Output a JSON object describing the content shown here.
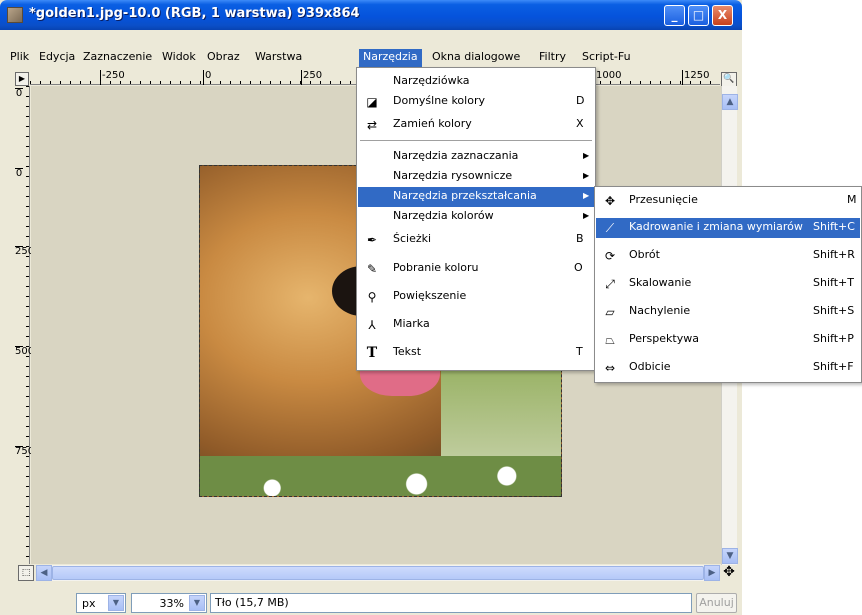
{
  "window": {
    "title": "*golden1.jpg-10.0 (RGB, 1 warstwa) 939x864",
    "minimize": "_",
    "maximize": "□",
    "close": "X"
  },
  "menubar": {
    "items": [
      "Plik",
      "Edycja",
      "Zaznaczenie",
      "Widok",
      "Obraz",
      "Warstwa",
      "Narzędzia",
      "Okna dialogowe",
      "Filtry",
      "Script-Fu"
    ],
    "active": "Narzędzia"
  },
  "rulers": {
    "top_labels": [
      "-250",
      "0",
      "250",
      "1000",
      "1250"
    ],
    "left_labels": [
      "0",
      "0",
      "250",
      "500",
      "750"
    ]
  },
  "tools_menu": {
    "items": [
      {
        "label": "Narzędziówka",
        "shortcut": "",
        "icon": "",
        "submenu": false
      },
      {
        "label": "Domyślne kolory",
        "shortcut": "D",
        "icon": "default-colors-icon",
        "submenu": false
      },
      {
        "label": "Zamień kolory",
        "shortcut": "X",
        "icon": "swap-colors-icon",
        "submenu": false
      },
      {
        "label": "Narzędzia zaznaczania",
        "shortcut": "",
        "icon": "",
        "submenu": true
      },
      {
        "label": "Narzędzia rysownicze",
        "shortcut": "",
        "icon": "",
        "submenu": true
      },
      {
        "label": "Narzędzia przekształcania",
        "shortcut": "",
        "icon": "",
        "submenu": true
      },
      {
        "label": "Narzędzia kolorów",
        "shortcut": "",
        "icon": "",
        "submenu": true
      },
      {
        "label": "Ścieżki",
        "shortcut": "B",
        "icon": "paths-icon",
        "submenu": false
      },
      {
        "label": "Pobranie koloru",
        "shortcut": "O",
        "icon": "color-picker-icon",
        "submenu": false
      },
      {
        "label": "Powiększenie",
        "shortcut": "",
        "icon": "magnify-icon",
        "submenu": false
      },
      {
        "label": "Miarka",
        "shortcut": "",
        "icon": "measure-icon",
        "submenu": false
      },
      {
        "label": "Tekst",
        "shortcut": "T",
        "icon": "text-icon",
        "submenu": false
      }
    ],
    "highlighted": "Narzędzia przekształcania"
  },
  "transform_submenu": {
    "items": [
      {
        "label": "Przesunięcie",
        "shortcut": "M",
        "icon": "move-icon"
      },
      {
        "label": "Kadrowanie i zmiana wymiarów",
        "shortcut": "Shift+C",
        "icon": "crop-icon"
      },
      {
        "label": "Obrót",
        "shortcut": "Shift+R",
        "icon": "rotate-icon"
      },
      {
        "label": "Skalowanie",
        "shortcut": "Shift+T",
        "icon": "scale-icon"
      },
      {
        "label": "Nachylenie",
        "shortcut": "Shift+S",
        "icon": "shear-icon"
      },
      {
        "label": "Perspektywa",
        "shortcut": "Shift+P",
        "icon": "perspective-icon"
      },
      {
        "label": "Odbicie",
        "shortcut": "Shift+F",
        "icon": "flip-icon"
      }
    ],
    "highlighted": "Kadrowanie i zmiana wymiarów"
  },
  "statusbar": {
    "unit": "px",
    "zoom": "33%",
    "status": "Tło (15,7 MB)",
    "cancel": "Anuluj"
  },
  "colors": {
    "titlebar": "#0553dc",
    "highlight": "#316ac5",
    "canvas_bg": "#d9d5c2"
  }
}
